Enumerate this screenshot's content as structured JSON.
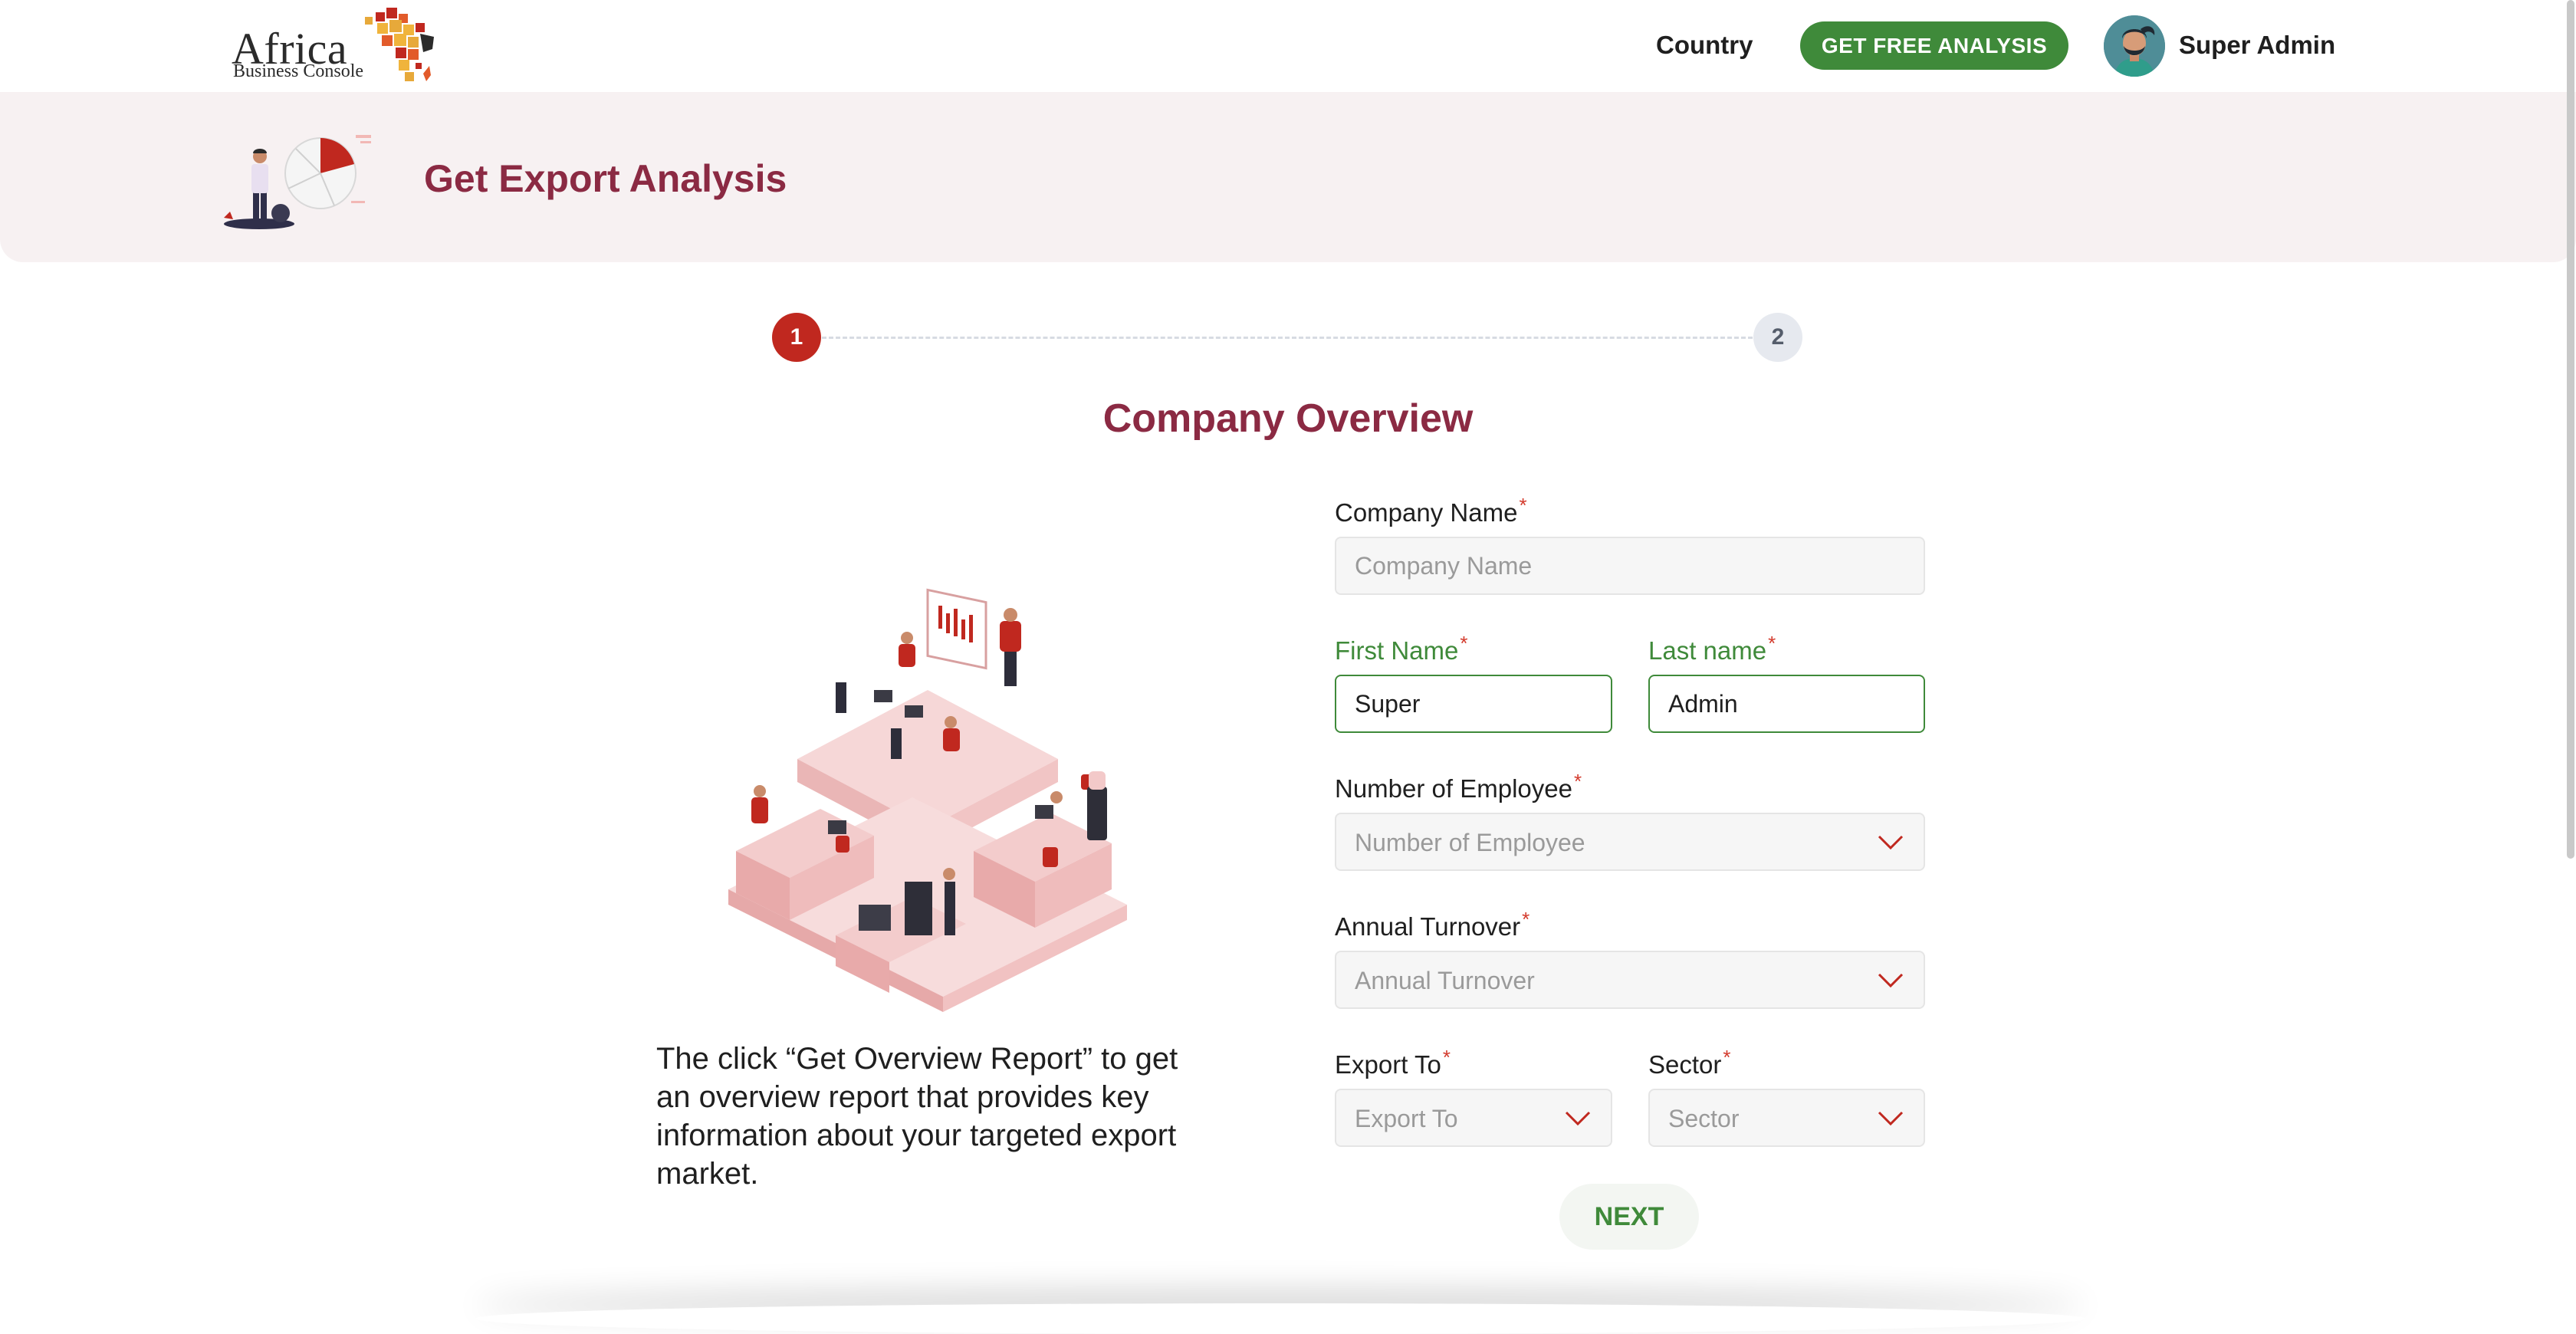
{
  "header": {
    "logo_word": "Africa",
    "logo_sub": "Business Console",
    "nav_country": "Country",
    "cta_label": "GET FREE ANALYSIS",
    "user_name": "Super Admin"
  },
  "banner": {
    "title": "Get Export Analysis"
  },
  "stepper": {
    "step1": "1",
    "step2": "2",
    "active_step": 1
  },
  "form": {
    "section_title": "Company Overview",
    "required_mark": "*",
    "company_name": {
      "label": "Company Name",
      "placeholder": "Company Name",
      "value": ""
    },
    "first_name": {
      "label": "First Name",
      "placeholder": "First Name",
      "value": "Super"
    },
    "last_name": {
      "label": "Last name",
      "placeholder": "Last name",
      "value": "Admin"
    },
    "employees": {
      "label": "Number of Employee",
      "placeholder": "Number of Employee"
    },
    "turnover": {
      "label": "Annual Turnover",
      "placeholder": "Annual Turnover"
    },
    "export_to": {
      "label": "Export To",
      "placeholder": "Export To"
    },
    "sector": {
      "label": "Sector",
      "placeholder": "Sector"
    },
    "next_label": "NEXT"
  },
  "description": "The click “Get Overview Report” to get an overview report that provides key information about your targeted export market.",
  "colors": {
    "brand_red": "#c0281f",
    "title_maroon": "#8b2a43",
    "accent_green": "#3f8a3a",
    "banner_bg": "#f7f1f2"
  },
  "icons": [
    "africa-map-logo",
    "person-avatar",
    "chevron-down-icon",
    "analysis-illustration",
    "office-illustration"
  ]
}
